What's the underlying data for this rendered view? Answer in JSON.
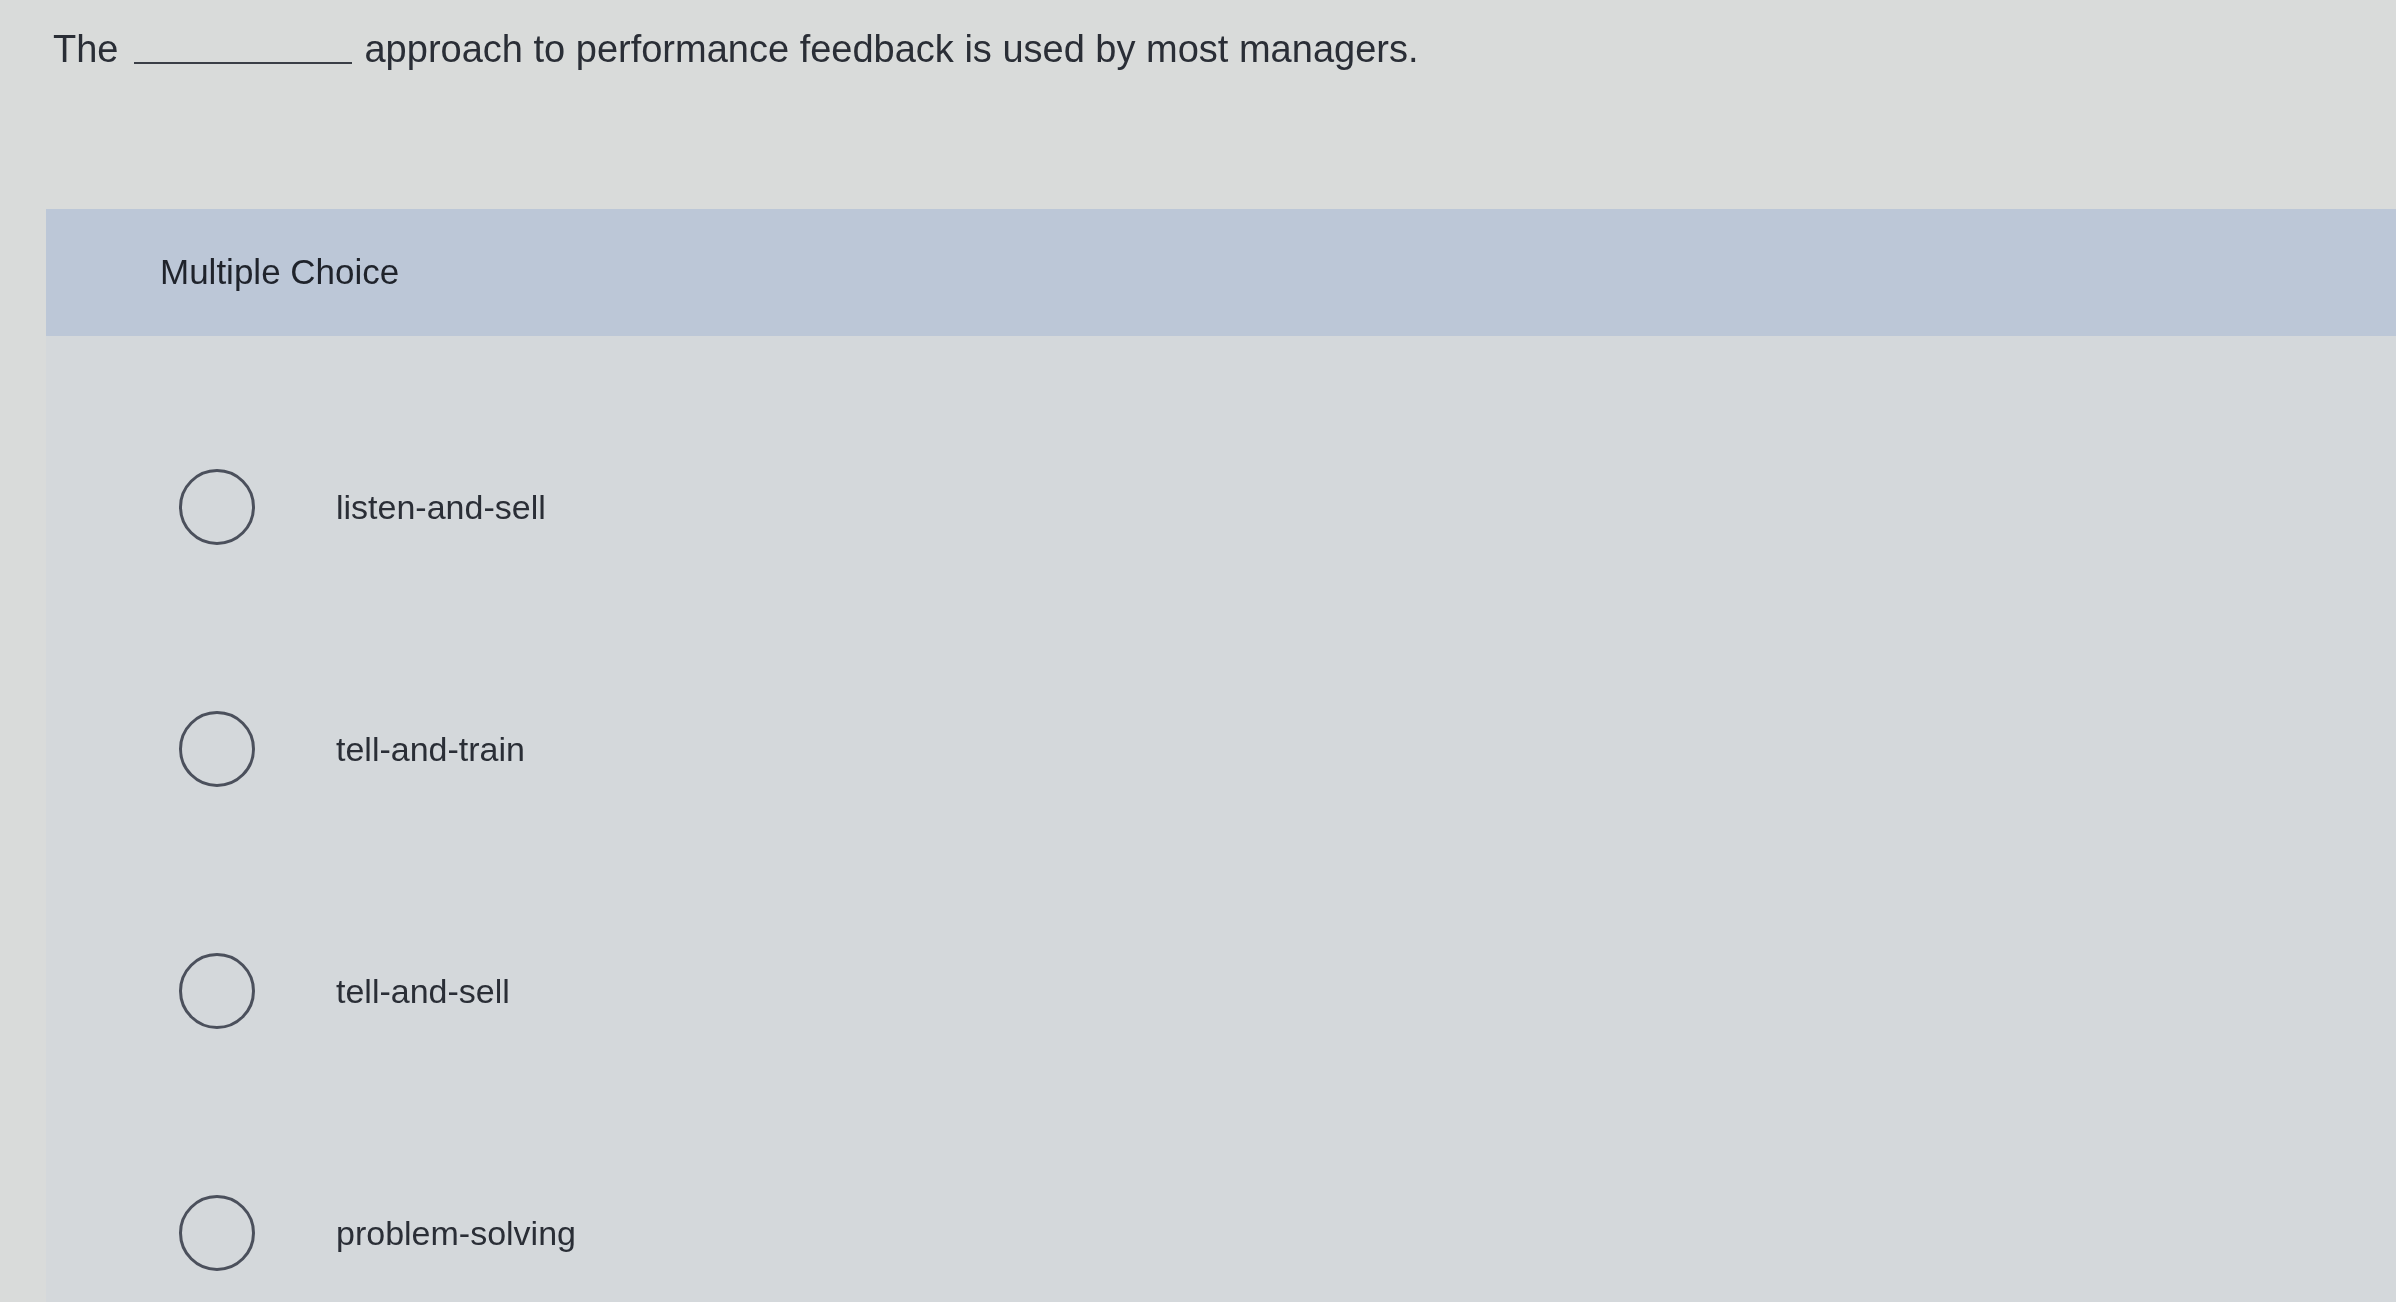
{
  "question": {
    "before_blank": "The",
    "after_blank": "approach to performance feedback is used by most managers."
  },
  "header": {
    "title": "Multiple Choice"
  },
  "options": [
    {
      "label": "listen-and-sell",
      "selected": false
    },
    {
      "label": "tell-and-train",
      "selected": false
    },
    {
      "label": "tell-and-sell",
      "selected": false
    },
    {
      "label": "problem-solving",
      "selected": false
    }
  ]
}
